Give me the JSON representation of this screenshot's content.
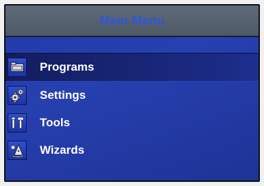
{
  "header": {
    "title": "Main Menu"
  },
  "menu": {
    "items": [
      {
        "label": "Programs",
        "icon": "folder-icon",
        "selected": true
      },
      {
        "label": "Settings",
        "icon": "gears-icon",
        "selected": false
      },
      {
        "label": "Tools",
        "icon": "tools-icon",
        "selected": false
      },
      {
        "label": "Wizards",
        "icon": "wizard-icon",
        "selected": false
      }
    ]
  },
  "colors": {
    "header_text": "#2f57d6",
    "screen_bg": "#2740b0",
    "selected_bg": "#131d5e",
    "item_text": "#ffffff"
  }
}
